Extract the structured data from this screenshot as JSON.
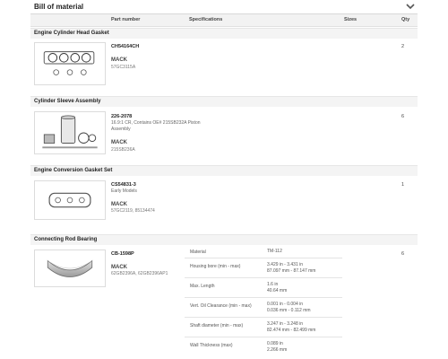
{
  "header": {
    "title": "Bill of material",
    "toggle_icon": "chevron-down-icon"
  },
  "columns": {
    "part_number": "Part number",
    "specifications": "Specifications",
    "sizes": "Sizes",
    "qty": "Qty"
  },
  "groups": [
    {
      "title": "Engine Cylinder Head Gasket",
      "part_number": "CH54164CH",
      "description": "",
      "brand": "MACK",
      "brand_part_numbers": "57GC3115A",
      "qty": "2",
      "image_icon": "gasket-set-icon"
    },
    {
      "title": "Cylinder Sleeve Assembly",
      "part_number": "226-2078",
      "description": "16.9:1 CR, Contains OE# 215SB232A Piston Assembly",
      "brand": "MACK",
      "brand_part_numbers": "215SB236A",
      "qty": "6",
      "image_icon": "cylinder-kit-icon"
    },
    {
      "title": "Engine Conversion Gasket Set",
      "part_number": "CS54831-3",
      "description": "Early Models",
      "brand": "MACK",
      "brand_part_numbers": "57GC2119, 85134474",
      "qty": "1",
      "image_icon": "gasket-icon"
    },
    {
      "title": "Connecting Rod Bearing",
      "part_number": "CB-1598P",
      "description": "",
      "brand": "MACK",
      "brand_part_numbers": "62GB2396A, 62GB2396AP1",
      "qty": "6",
      "image_icon": "bearing-icon",
      "specs": [
        {
          "label": "Material",
          "value_1": "TM-112",
          "value_2": ""
        },
        {
          "label": "Housing bore (min - max)",
          "value_1": "3.429 in - 3.431 in",
          "value_2": "87.097 mm - 87.147 mm"
        },
        {
          "label": "Max. Length",
          "value_1": "1.6 in",
          "value_2": "40.64 mm"
        },
        {
          "label": "Vert. Oil Clearance (min - max)",
          "value_1": "0.001 in - 0.004 in",
          "value_2": "0.036 mm - 0.112 mm"
        },
        {
          "label": "Shaft diameter (min - max)",
          "value_1": "3.247 in - 3.248 in",
          "value_2": "82.474 mm - 82.499 mm"
        },
        {
          "label": "Wall Thickness (max)",
          "value_1": "0.089 in",
          "value_2": "2.266 mm"
        }
      ]
    }
  ]
}
